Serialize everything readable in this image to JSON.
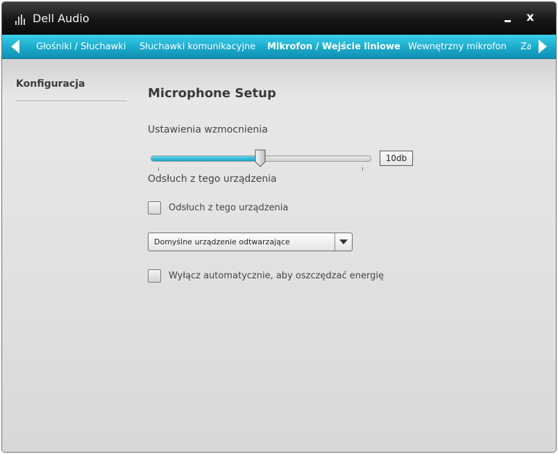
{
  "window": {
    "title": "Dell Audio",
    "close_glyph": "x"
  },
  "tabs": [
    {
      "label": "Głośniki / Słuchawki",
      "active": false
    },
    {
      "label": "Słuchawki komunikacyjne",
      "active": false
    },
    {
      "label": "Mikrofon / Wejście liniowe",
      "active": true
    },
    {
      "label": "Wewnętrzny mikrofon",
      "active": false
    },
    {
      "label": "Zaa",
      "active": false
    }
  ],
  "sidebar": {
    "items": [
      {
        "label": "Konfiguracja"
      }
    ]
  },
  "main": {
    "title": "Microphone Setup",
    "gain": {
      "label": "Ustawienia wzmocnienia",
      "value_text": "10db",
      "level_fraction": 0.5
    },
    "monitoring": {
      "section_label": "Odsłuch z tego urządzenia",
      "checkbox_label": "Odsłuch z tego urządzenia",
      "checked": false
    },
    "playback_device": {
      "selected": "Domyślne urządzenie odtwarzające"
    },
    "power_saving": {
      "checkbox_label": "Wyłącz automatycznie, aby oszczędzać energię",
      "checked": false
    }
  },
  "colors": {
    "accent": "#1aa9cb",
    "titlebar": "#161616",
    "background": "#dcdcdc"
  },
  "icons": {
    "app": "equalizer-bars-icon",
    "tab_left": "arrow-left-icon",
    "tab_right": "arrow-right-icon",
    "dropdown": "chevron-down-icon"
  }
}
